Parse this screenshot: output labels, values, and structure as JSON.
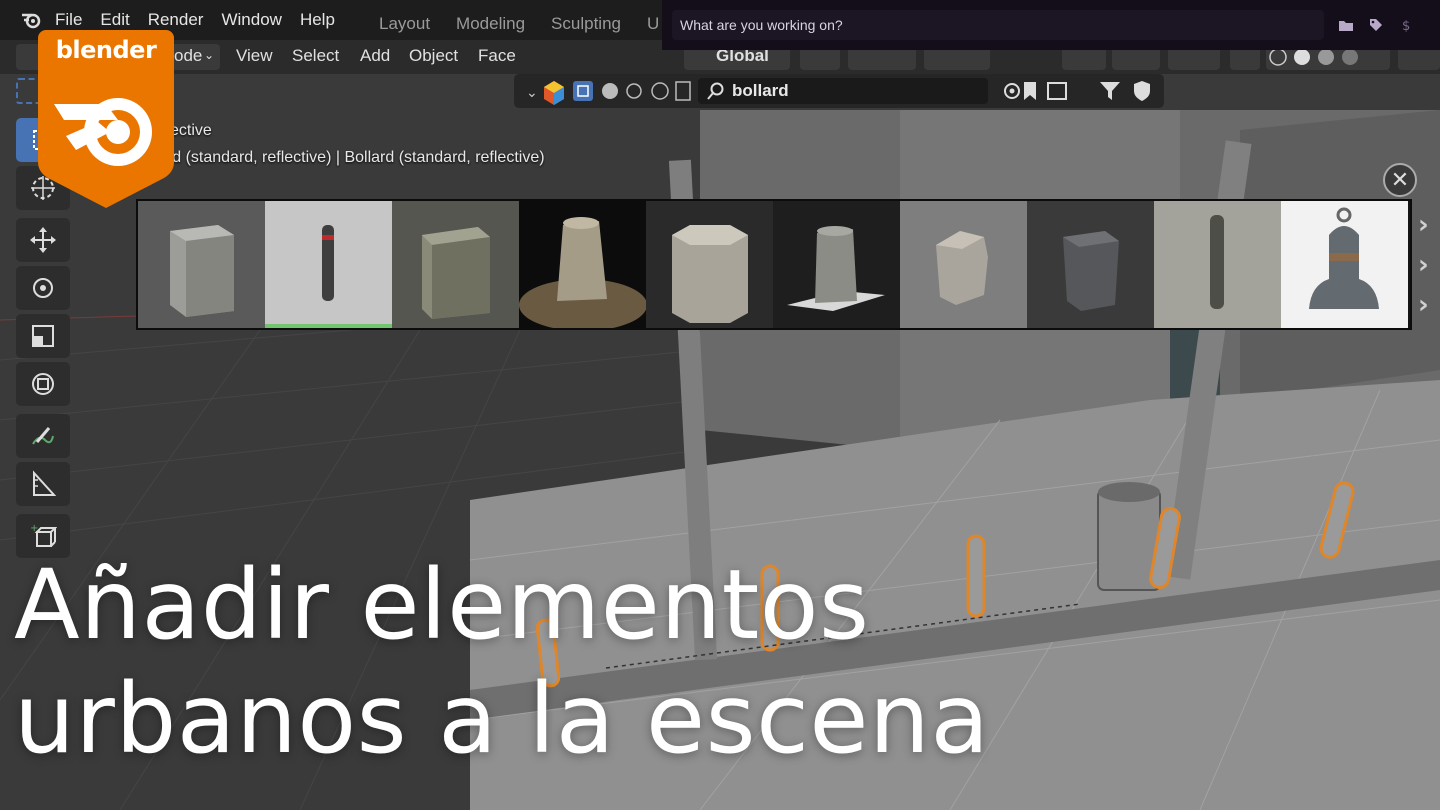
{
  "menubar": {
    "items": [
      "File",
      "Edit",
      "Render",
      "Window",
      "Help"
    ],
    "workspace_tabs": [
      "Layout",
      "Modeling",
      "Sculpting",
      "U"
    ]
  },
  "header": {
    "mode_label": "ode",
    "items": [
      "View",
      "Select",
      "Add",
      "Object",
      "Face"
    ],
    "transform_orientation": "Global"
  },
  "asset_browser": {
    "search_query": "bollard"
  },
  "work_panel": {
    "placeholder": "What are you working on?",
    "icons": [
      "folder-icon",
      "tag-icon",
      "dollar-icon"
    ]
  },
  "viewport": {
    "view_label": "ective",
    "object_label": "ard (standard, reflective) | Bollard (standard, reflective)"
  },
  "toolbar": {
    "tools": [
      "select-box-icon",
      "cursor-icon",
      "move-icon",
      "rotate-icon",
      "scale-icon",
      "transform-icon",
      "annotate-icon",
      "measure-icon",
      "add-cube-icon"
    ]
  },
  "asset_strip": {
    "thumbnails": [
      "concrete-block",
      "thin-metal-post",
      "stone-block",
      "worn-stone-post",
      "octagonal-stone",
      "tapered-concrete",
      "broken-concrete",
      "dark-stone-block",
      "tall-pole",
      "bell-bollard"
    ],
    "selected_index": 1,
    "close_symbol": "✕",
    "arrows": [
      "›",
      "›",
      "›"
    ]
  },
  "badge": {
    "brand": "blender",
    "color": "#ea7600"
  },
  "caption": {
    "line1": "Añadir elementos",
    "line2": "urbanos a la escena"
  }
}
